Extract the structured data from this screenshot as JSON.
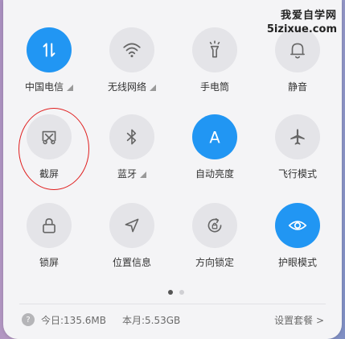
{
  "watermark": {
    "line1": "我爱自学网",
    "line2": "5izixue.com"
  },
  "accent_color": "#2196f3",
  "annotation_color": "#e02020",
  "tiles": [
    {
      "label": "中国电信",
      "icon": "mobile-data-icon",
      "active": true,
      "has_arrow": true
    },
    {
      "label": "无线网络",
      "icon": "wifi-icon",
      "active": false,
      "has_arrow": true
    },
    {
      "label": "手电筒",
      "icon": "flashlight-icon",
      "active": false,
      "has_arrow": false
    },
    {
      "label": "静音",
      "icon": "bell-icon",
      "active": false,
      "has_arrow": false
    },
    {
      "label": "截屏",
      "icon": "screenshot-icon",
      "active": false,
      "has_arrow": false
    },
    {
      "label": "蓝牙",
      "icon": "bluetooth-icon",
      "active": false,
      "has_arrow": true
    },
    {
      "label": "自动亮度",
      "icon": "auto-brightness-icon",
      "active": true,
      "has_arrow": false,
      "icon_text": "A"
    },
    {
      "label": "飞行模式",
      "icon": "airplane-icon",
      "active": false,
      "has_arrow": false
    },
    {
      "label": "锁屏",
      "icon": "lock-icon",
      "active": false,
      "has_arrow": false
    },
    {
      "label": "位置信息",
      "icon": "location-icon",
      "active": false,
      "has_arrow": false
    },
    {
      "label": "方向锁定",
      "icon": "rotation-lock-icon",
      "active": false,
      "has_arrow": false
    },
    {
      "label": "护眼模式",
      "icon": "eye-icon",
      "active": true,
      "has_arrow": false
    }
  ],
  "pagination": {
    "pages": 2,
    "current": 1
  },
  "footer": {
    "help_icon": "?",
    "today": "今日:135.6MB",
    "month": "本月:5.53GB",
    "plan_link": "设置套餐 >"
  }
}
